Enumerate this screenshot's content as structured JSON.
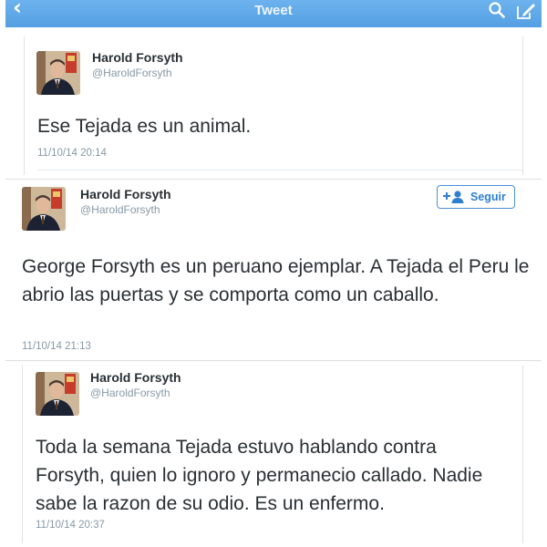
{
  "nav": {
    "title": "Tweet",
    "back_icon": "chevron-left-icon",
    "search_icon": "search-icon",
    "compose_icon": "compose-icon",
    "bar_color": "#5fa8e8"
  },
  "tweets": [
    {
      "name": "Harold Forsyth",
      "handle": "@HaroldForsyth",
      "text": "Ese Tejada es un animal.",
      "timestamp": "11/10/14 20:14"
    },
    {
      "name": "Harold Forsyth",
      "handle": "@HaroldForsyth",
      "follow_label": "Seguir",
      "text": "George Forsyth es un peruano ejemplar. A Tejada el Peru le abrio las puertas y se comporta como un caballo.",
      "timestamp": "11/10/14 21:13"
    },
    {
      "name": "Harold Forsyth",
      "handle": "@HaroldForsyth",
      "text": "Toda la semana Tejada estuvo hablando contra Forsyth, quien lo ignoro y permanecio callado. Nadie sabe la razon de su odio. Es un enfermo.",
      "timestamp": "11/10/14 20:37"
    }
  ]
}
